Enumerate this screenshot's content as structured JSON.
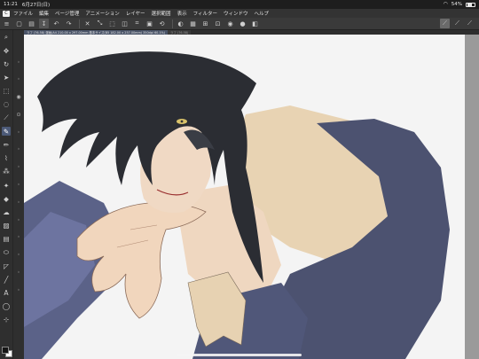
{
  "statusbar": {
    "time": "11:21",
    "date": "6月27日(日)",
    "battery": "54%",
    "wifi_icon": "wifi-icon",
    "battery_icon": "battery-icon"
  },
  "menubar": {
    "logo": "C",
    "items": [
      "ファイル",
      "編集",
      "ページ管理",
      "アニメーション",
      "レイヤー",
      "選択範囲",
      "表示",
      "フィルター",
      "ウィンドウ",
      "ヘルプ"
    ]
  },
  "commandbar": {
    "left_icons": [
      "menu-icon",
      "new-icon",
      "open-icon",
      "save-icon",
      "undo-icon",
      "redo-icon",
      "clear-icon",
      "transform-icon",
      "select-all-icon",
      "deselect-icon",
      "crop-icon",
      "fill-icon",
      "rotate-icon",
      "invert-icon",
      "ruler-icon",
      "grid-icon",
      "snap-icon",
      "eye-icon",
      "dark-icon",
      "layer-icon"
    ],
    "right_icons": [
      "pen-stroke-icon",
      "pen-pressure-icon",
      "pen-taper-icon"
    ]
  },
  "tabs": [
    {
      "label": "ラフ (76.58) 漫画(A4 210.00 x 297.00mm 基本サイズ(B5 182.00 x 257.00mm) 350dpi 60.1%)",
      "active": true
    },
    {
      "label": "ラフ (76.58)",
      "active": false
    }
  ],
  "toolbar": {
    "main_tools": [
      "zoom-icon",
      "move-icon",
      "rotate-icon",
      "object-icon",
      "selection-icon",
      "lasso-icon",
      "eyedropper-icon",
      "pen-icon",
      "pencil-icon",
      "brush-icon",
      "airbrush-icon",
      "decoration-icon",
      "eraser-icon",
      "blend-icon",
      "fill-icon",
      "gradient-icon",
      "figure-icon",
      "frame-icon",
      "ruler-icon",
      "text-icon",
      "balloon-icon",
      "correction-icon"
    ],
    "selected_tool": "pen-icon",
    "sub_tools": [
      "sub-tool-1-icon",
      "sub-tool-2-icon",
      "sub-tool-3-icon",
      "sub-tool-4-icon",
      "sub-tool-5-icon",
      "sub-tool-6-icon",
      "sub-tool-7-icon",
      "sub-tool-8-icon",
      "sub-tool-9-icon",
      "sub-tool-10-icon",
      "sub-tool-11-icon",
      "sub-tool-12-icon",
      "sub-tool-13-icon",
      "sub-tool-14-icon"
    ],
    "main_color": "#151515",
    "sub_color": "#ffffff"
  },
  "colors": {
    "accent": "#4c5a78",
    "panel": "#2f2f2f",
    "canvas_bg": "#ececec"
  }
}
